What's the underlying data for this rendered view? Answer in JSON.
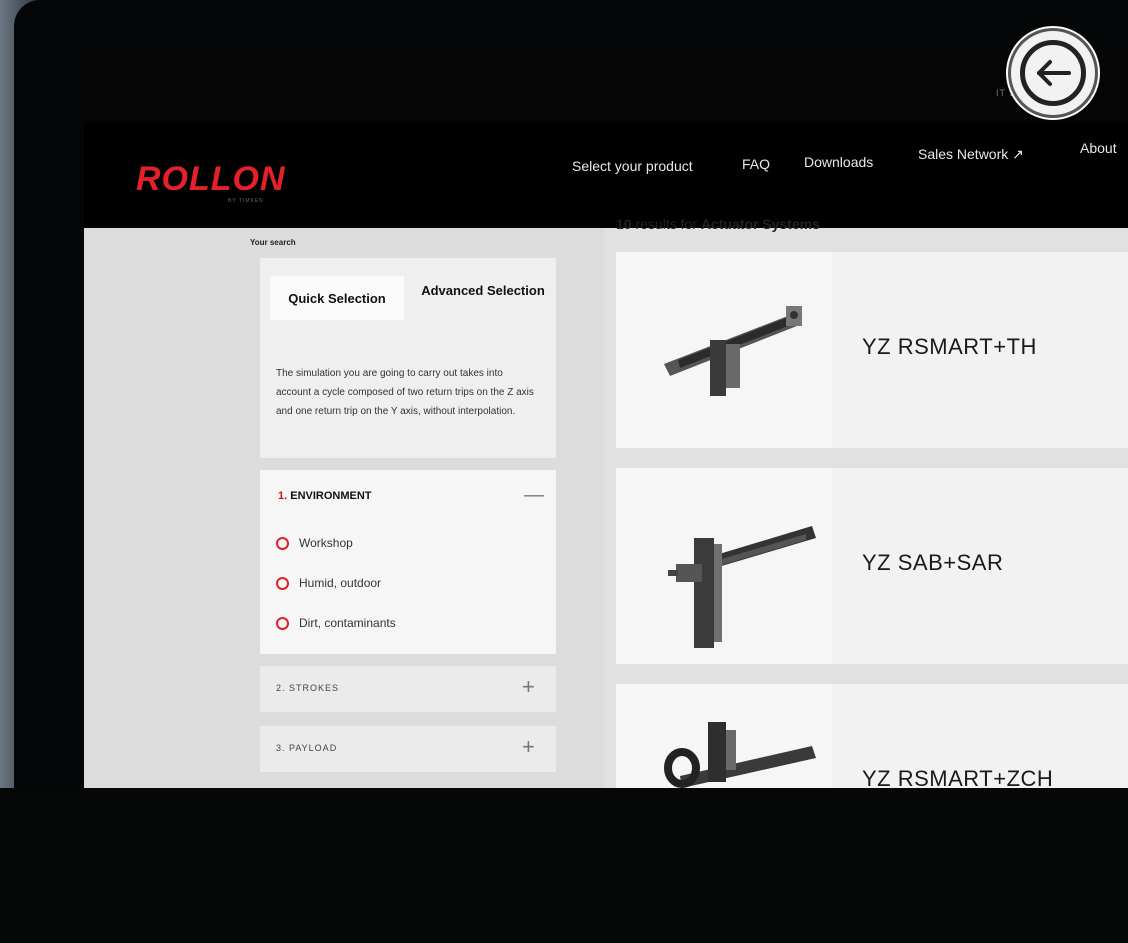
{
  "brand": {
    "logo": "ROLLON",
    "logo_sub": "BY TIMKEN"
  },
  "topbar": {
    "lang": "IT     SEARCH"
  },
  "nav": {
    "items": [
      "Select your product",
      "FAQ",
      "Downloads",
      "Sales Network ↗",
      "About"
    ]
  },
  "sidebar": {
    "your_search": "Your search",
    "tabs": {
      "quick": "Quick Selection",
      "advanced": "Advanced Selection"
    },
    "description": "The simulation you are going to carry out takes into account a cycle composed of two return trips on the Z axis and one return trip on the Y axis, without interpolation.",
    "environment": {
      "number": "1.",
      "title": "ENVIRONMENT",
      "toggle": "—",
      "options": [
        "Workshop",
        "Humid, outdoor",
        "Dirt, contaminants"
      ]
    },
    "accordions": [
      {
        "label": "2. STROKES",
        "toggle": "+"
      },
      {
        "label": "3. PAYLOAD",
        "toggle": "+"
      }
    ]
  },
  "results": {
    "count": "10",
    "prefix": "results for",
    "query": "Actuator Systems",
    "items": [
      {
        "name": "YZ RSMART+TH"
      },
      {
        "name": "YZ SAB+SAR"
      },
      {
        "name": "YZ RSMART+ZCH"
      }
    ]
  },
  "colors": {
    "brand_red": "#e4202a",
    "nav_bg": "#000000",
    "content_bg": "#e1e1e1"
  },
  "icons": {
    "back": "arrow-left-circle-icon"
  }
}
